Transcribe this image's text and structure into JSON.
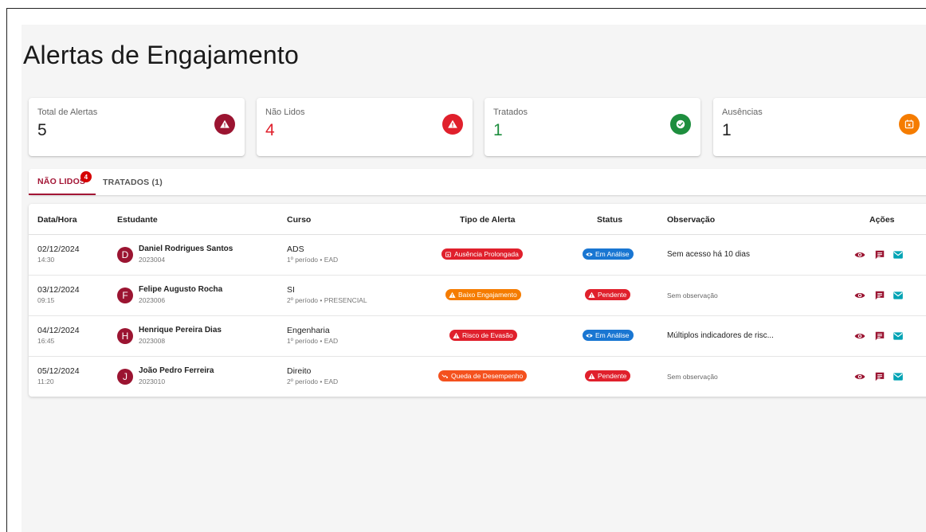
{
  "page": {
    "title": "Alertas de Engajamento"
  },
  "colors": {
    "primary": "#9b1431",
    "danger": "#e0202c",
    "success": "#1e8e3e",
    "warning": "#f57c00",
    "info": "#1976d2",
    "orange": "#f4511e"
  },
  "stats": [
    {
      "label": "Total de Alertas",
      "value": "5",
      "icon": "warning-icon",
      "color": "#9b1431"
    },
    {
      "label": "Não Lidos",
      "value": "4",
      "icon": "warning-icon",
      "color": "#e0202c"
    },
    {
      "label": "Tratados",
      "value": "1",
      "icon": "check-circle-icon",
      "color": "#1e8e3e"
    },
    {
      "label": "Ausências",
      "value": "1",
      "icon": "calendar-x-icon",
      "color": "#f57c00"
    }
  ],
  "tabs": [
    {
      "label": "NÃO LIDOS",
      "badge": "4",
      "active": true
    },
    {
      "label": "TRATADOS (1)",
      "active": false
    }
  ],
  "table": {
    "headers": {
      "date": "Data/Hora",
      "student": "Estudante",
      "course": "Curso",
      "alert_type": "Tipo de Alerta",
      "status": "Status",
      "observation": "Observação",
      "actions": "Ações"
    },
    "rows": [
      {
        "date": "02/12/2024",
        "time": "14:30",
        "initial": "D",
        "name": "Daniel Rodrigues Santos",
        "id": "2023004",
        "course": "ADS",
        "course_detail": "1º período • EAD",
        "alert": "Ausência Prolongada",
        "alert_icon": "calendar-x-icon",
        "alert_color": "#e0202c",
        "status": "Em Análise",
        "status_icon": "eye-icon",
        "status_color": "#1976d2",
        "observation": "Sem acesso há 10 dias",
        "obs_muted": false
      },
      {
        "date": "03/12/2024",
        "time": "09:15",
        "initial": "F",
        "name": "Felipe Augusto Rocha",
        "id": "2023006",
        "course": "SI",
        "course_detail": "2º período • PRESENCIAL",
        "alert": "Baixo Engajamento",
        "alert_icon": "warning-icon",
        "alert_color": "#f57c00",
        "status": "Pendente",
        "status_icon": "warning-icon",
        "status_color": "#e0202c",
        "observation": "Sem observação",
        "obs_muted": true
      },
      {
        "date": "04/12/2024",
        "time": "16:45",
        "initial": "H",
        "name": "Henrique Pereira Dias",
        "id": "2023008",
        "course": "Engenharia",
        "course_detail": "1º período • EAD",
        "alert": "Risco de Evasão",
        "alert_icon": "warning-icon",
        "alert_color": "#e0202c",
        "status": "Em Análise",
        "status_icon": "eye-icon",
        "status_color": "#1976d2",
        "observation": "Múltiplos indicadores de risc...",
        "obs_muted": false
      },
      {
        "date": "05/12/2024",
        "time": "11:20",
        "initial": "J",
        "name": "João Pedro Ferreira",
        "id": "2023010",
        "course": "Direito",
        "course_detail": "2º período • EAD",
        "alert": "Queda de Desempenho",
        "alert_icon": "trending-down-icon",
        "alert_color": "#f4511e",
        "status": "Pendente",
        "status_icon": "warning-icon",
        "status_color": "#e0202c",
        "observation": "Sem observação",
        "obs_muted": true
      }
    ],
    "actions": [
      {
        "icon": "eye-icon",
        "color": "#9b1431"
      },
      {
        "icon": "comment-icon",
        "color": "#9b1431"
      },
      {
        "icon": "mail-icon",
        "color": "#00a3b4"
      }
    ]
  }
}
